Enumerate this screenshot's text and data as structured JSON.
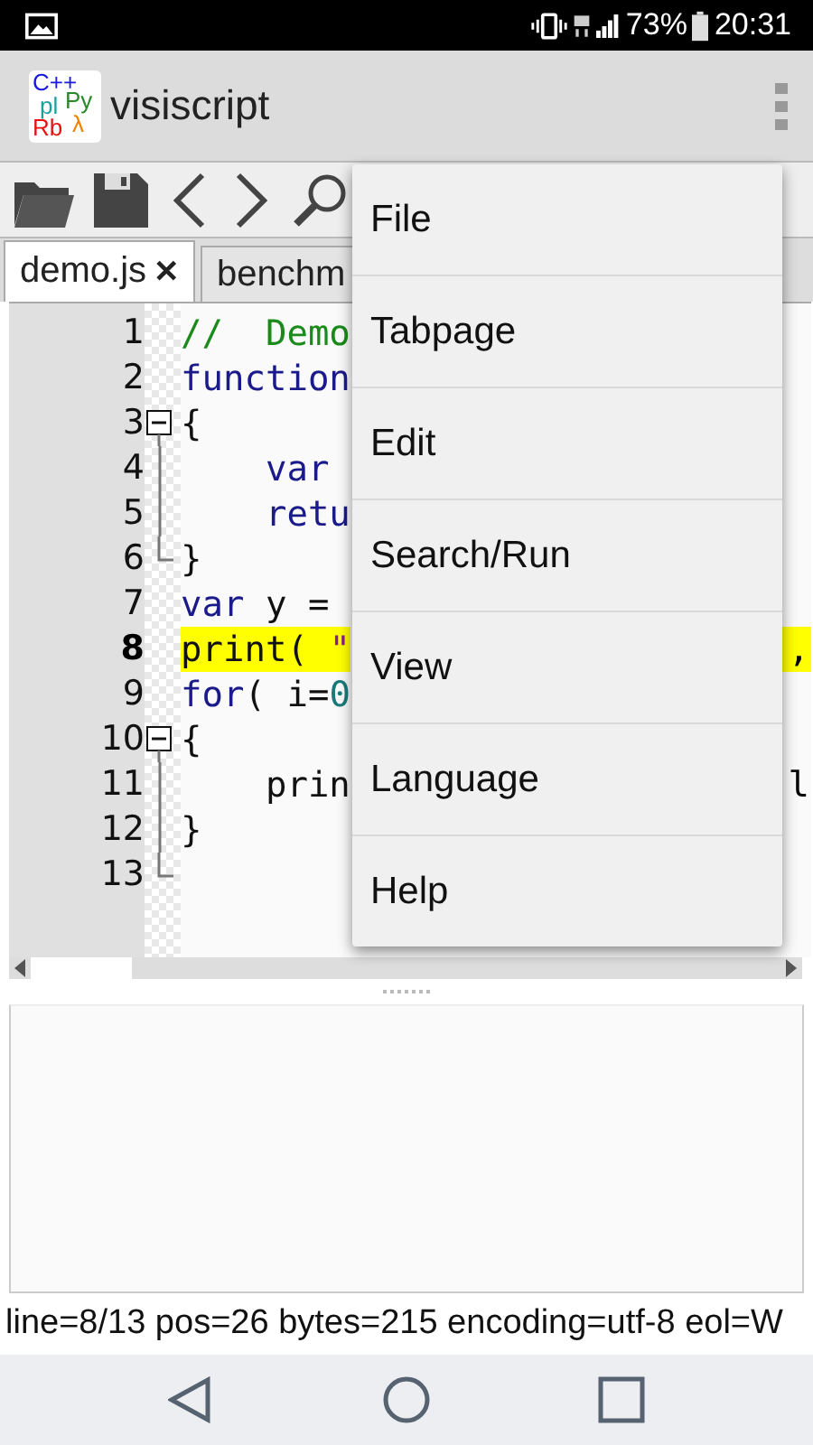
{
  "status_bar": {
    "battery": "73%",
    "time": "20:31"
  },
  "app_bar": {
    "logo": [
      {
        "text": "C++",
        "color": "#1a1adf"
      },
      {
        "text": "pl",
        "color": "#1aa0a0"
      },
      {
        "text": "Py",
        "color": "#2a8a2a"
      },
      {
        "text": "Rb",
        "color": "#e81010"
      },
      {
        "text": "λ",
        "color": "#f08000"
      }
    ],
    "title": "visiscript"
  },
  "tabs": [
    {
      "label": "demo.js",
      "selected": true,
      "close": "✕"
    },
    {
      "label": "benchm",
      "selected": false
    }
  ],
  "editor": {
    "lines": [
      {
        "number": "1",
        "kind": "plain",
        "highlighted": false,
        "code": [
          {
            "kind": "comment",
            "text": "//  Demo"
          }
        ]
      },
      {
        "number": "2",
        "kind": "plain",
        "highlighted": false,
        "code": [
          {
            "kind": "keyword",
            "text": "function"
          }
        ]
      },
      {
        "number": "3",
        "kind": "fold_start",
        "expanded": true,
        "highlighted": false,
        "code": [
          {
            "kind": "plain",
            "text": "{"
          }
        ]
      },
      {
        "number": "4",
        "kind": "fold_inner",
        "highlighted": false,
        "code": [
          {
            "kind": "keyword",
            "text": "    var"
          }
        ]
      },
      {
        "number": "5",
        "kind": "fold_inner",
        "highlighted": false,
        "code": [
          {
            "kind": "keyword",
            "text": "    retu"
          }
        ]
      },
      {
        "number": "6",
        "kind": "fold_end",
        "highlighted": false,
        "code": [
          {
            "kind": "plain",
            "text": "}"
          }
        ]
      },
      {
        "number": "7",
        "kind": "plain",
        "highlighted": false,
        "code": [
          {
            "kind": "keyword",
            "text": "var"
          },
          {
            "kind": "plain",
            "text": " y ="
          }
        ]
      },
      {
        "number": "8",
        "kind": "plain",
        "highlighted": true,
        "code": [
          {
            "kind": "plain",
            "text": "print( "
          },
          {
            "kind": "string",
            "text": "\""
          }
        ],
        "tail": ","
      },
      {
        "number": "9",
        "kind": "plain",
        "highlighted": false,
        "code": [
          {
            "kind": "keyword",
            "text": "for"
          },
          {
            "kind": "plain",
            "text": "( i="
          },
          {
            "kind": "number",
            "text": "0"
          }
        ]
      },
      {
        "number": "10",
        "kind": "fold_start",
        "expanded": true,
        "highlighted": false,
        "code": [
          {
            "kind": "plain",
            "text": "{"
          }
        ]
      },
      {
        "number": "11",
        "kind": "fold_inner",
        "highlighted": false,
        "code": [
          {
            "kind": "plain",
            "text": "    prin"
          }
        ],
        "tail": "l"
      },
      {
        "number": "12",
        "kind": "fold_inner",
        "highlighted": false,
        "code": [
          {
            "kind": "plain",
            "text": "}"
          }
        ]
      },
      {
        "number": "13",
        "kind": "fold_end",
        "highlighted": false
      }
    ]
  },
  "menu": {
    "items": [
      "File",
      "Tabpage",
      "Edit",
      "Search/Run",
      "View",
      "Language",
      "Help"
    ]
  },
  "info_line": "line=8/13 pos=26 bytes=215 encoding=utf-8 eol=W"
}
